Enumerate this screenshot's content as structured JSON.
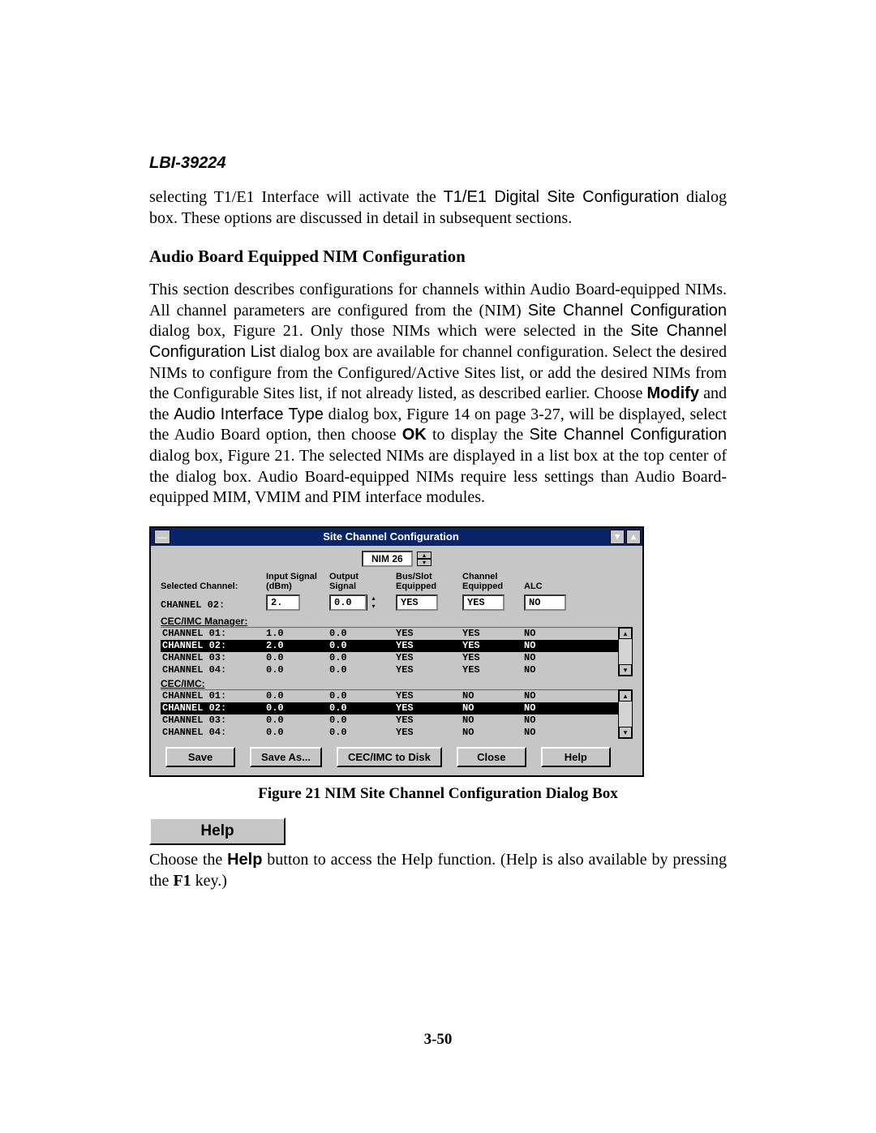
{
  "docId": "LBI-39224",
  "intro": {
    "pre": "selecting T1/E1 Interface will activate the ",
    "sans1": "T1/E1 Digital Site Configuration",
    "post1": " dialog box.  These options are discussed in detail in subsequent sections."
  },
  "heading": "Audio Board Equipped NIM Configuration",
  "body": {
    "p1a": "This section describes configurations for channels within Audio Board-equipped NIMs.  All channel parameters are configured from the (NIM) ",
    "p1sans1": "Site Channel Configuration",
    "p1b": " dialog box, Figure 21.  Only those NIMs which were selected in the ",
    "p1sans2": "Site Channel Configuration List",
    "p1c": " dialog box are available for channel configuration.  Select the desired NIMs to configure from the Configured/Active Sites list, or add the desired NIMs from the Configurable Sites list, if not already listed, as described earlier. Choose ",
    "p1boldModify": "Modify",
    "p1d": " and the ",
    "p1sans3": "Audio Interface Type",
    "p1e": " dialog box, Figure 14 on page 3-27, will be displayed, select the Audio Board option, then choose ",
    "p1boldOK": "OK",
    "p1f": " to display the ",
    "p1sans4": "Site Channel Configuration",
    "p1g": " dialog box, Figure 21.  The selected NIMs are displayed in a list box at the top center of the dialog box.  Audio Board-equipped NIMs require less settings than Audio Board-equipped MIM, VMIM and PIM interface modules."
  },
  "dialog": {
    "title": "Site Channel Configuration",
    "nimLabel": "NIM  26",
    "headers": {
      "selected": "Selected Channel:",
      "input": "Input Signal\n(dBm)",
      "output": "Output\nSignal",
      "bus": "Bus/Slot\nEquipped",
      "channel": "Channel\nEquipped",
      "alc": "ALC"
    },
    "selected": {
      "label": "CHANNEL 02:",
      "input": "2.",
      "output": "0.0",
      "bus": "YES",
      "channel": "YES",
      "alc": "NO"
    },
    "section1Label": "CEC/IMC Manager:",
    "list1": [
      {
        "ch": "CHANNEL  01:",
        "in": "1.0",
        "out": "0.0",
        "bus": "YES",
        "chan": "YES",
        "alc": "NO",
        "sel": false
      },
      {
        "ch": "CHANNEL  02:",
        "in": "2.0",
        "out": "0.0",
        "bus": "YES",
        "chan": "YES",
        "alc": "NO",
        "sel": true
      },
      {
        "ch": "CHANNEL  03:",
        "in": "0.0",
        "out": "0.0",
        "bus": "YES",
        "chan": "YES",
        "alc": "NO",
        "sel": false
      },
      {
        "ch": "CHANNEL  04:",
        "in": "0.0",
        "out": "0.0",
        "bus": "YES",
        "chan": "YES",
        "alc": "NO",
        "sel": false
      }
    ],
    "section2Label": "CEC/IMC:",
    "list2": [
      {
        "ch": "CHANNEL  01:",
        "in": "0.0",
        "out": "0.0",
        "bus": "YES",
        "chan": "NO",
        "alc": "NO",
        "sel": false
      },
      {
        "ch": "CHANNEL  02:",
        "in": "0.0",
        "out": "0.0",
        "bus": "YES",
        "chan": "NO",
        "alc": "NO",
        "sel": true
      },
      {
        "ch": "CHANNEL  03:",
        "in": "0.0",
        "out": "0.0",
        "bus": "YES",
        "chan": "NO",
        "alc": "NO",
        "sel": false
      },
      {
        "ch": "CHANNEL  04:",
        "in": "0.0",
        "out": "0.0",
        "bus": "YES",
        "chan": "NO",
        "alc": "NO",
        "sel": false
      }
    ],
    "buttons": {
      "save": "Save",
      "saveAs": "Save As...",
      "toDisk": "CEC/IMC to Disk",
      "close": "Close",
      "help": "Help"
    }
  },
  "figureCaption": "Figure 21  NIM Site Channel Configuration Dialog Box",
  "helpBtn": "Help",
  "helpPara": {
    "a": "Choose the ",
    "bold": "Help",
    "b": " button to access the Help function. (Help is also available by pressing the ",
    "key": "F1",
    "c": " key.)"
  },
  "pageNumber": "3-50"
}
